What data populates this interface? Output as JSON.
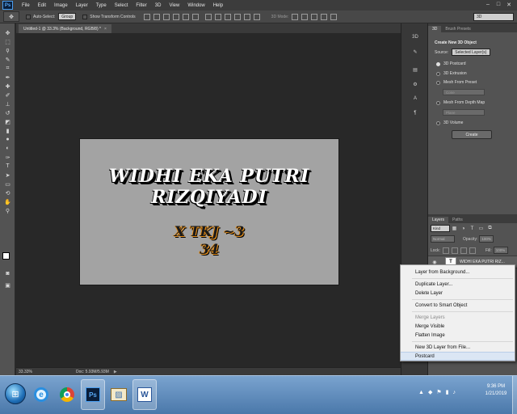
{
  "app": {
    "logo": "Ps"
  },
  "menubar": {
    "items": [
      "File",
      "Edit",
      "Image",
      "Layer",
      "Type",
      "Select",
      "Filter",
      "3D",
      "View",
      "Window",
      "Help"
    ],
    "window_controls": [
      "–",
      "□",
      "✕"
    ]
  },
  "options": {
    "auto_select_label": "Auto-Select:",
    "auto_select_value": "Group",
    "show_transform_label": "Show Transform Controls",
    "mode_label": "3D Mode:",
    "workspace": "3D"
  },
  "document": {
    "tab_title": "Untitled-1 @ 33.3% (Background, RGB/8) *",
    "tab_close": "×",
    "art_lines": [
      "WIDHI EKA PUTRI",
      "RIZQIYADI",
      "X TKJ ~3",
      "34"
    ]
  },
  "statusbar": {
    "zoom": "33.33%",
    "doc_info": "Doc: 5.93M/5.93M",
    "arrow": "▶"
  },
  "panels": {
    "top_tabs": [
      "3D",
      "Brush Presets"
    ],
    "create_title": "Create New 3D Object",
    "source_label": "Source:",
    "source_value": "Selected Layer(s)",
    "options": [
      {
        "label": "3D Postcard",
        "selected": true
      },
      {
        "label": "3D Extrusion",
        "selected": false
      },
      {
        "label": "Mesh From Preset",
        "selected": false
      },
      {
        "label": "Mesh From Depth Map",
        "selected": false
      },
      {
        "label": "3D Volume",
        "selected": false
      }
    ],
    "preset_value": "Cone",
    "depth_value": "Plane",
    "create_button": "Create"
  },
  "layers": {
    "tabs": [
      "Layers",
      "Paths"
    ],
    "kind": "Kind",
    "blend_mode": "Normal",
    "opacity_label": "Opacity:",
    "opacity_value": "100%",
    "lock_label": "Lock:",
    "fill_label": "Fill:",
    "fill_value": "100%",
    "layer_name": "WIDHI EKA PUTRI RIZ..."
  },
  "context_menu": {
    "items": [
      {
        "label": "Layer from Background...",
        "disabled": false
      },
      {
        "label": "Duplicate Layer...",
        "disabled": false
      },
      {
        "label": "Delete Layer",
        "disabled": false
      },
      {
        "label": "Convert to Smart Object",
        "disabled": false
      },
      {
        "label": "Merge Layers",
        "disabled": true
      },
      {
        "label": "Merge Visible",
        "disabled": false
      },
      {
        "label": "Flatten Image",
        "disabled": false
      },
      {
        "label": "New 3D Layer from File...",
        "disabled": false
      },
      {
        "label": "Postcard",
        "disabled": false,
        "highlighted": true
      }
    ]
  },
  "taskbar": {
    "clock_time": "9:36 PM",
    "clock_date": "1/21/2019"
  },
  "colors": {
    "doc_background": "#a3a3a3",
    "accent_orange": "#e8901a",
    "ps_blue": "#59a9f5"
  }
}
